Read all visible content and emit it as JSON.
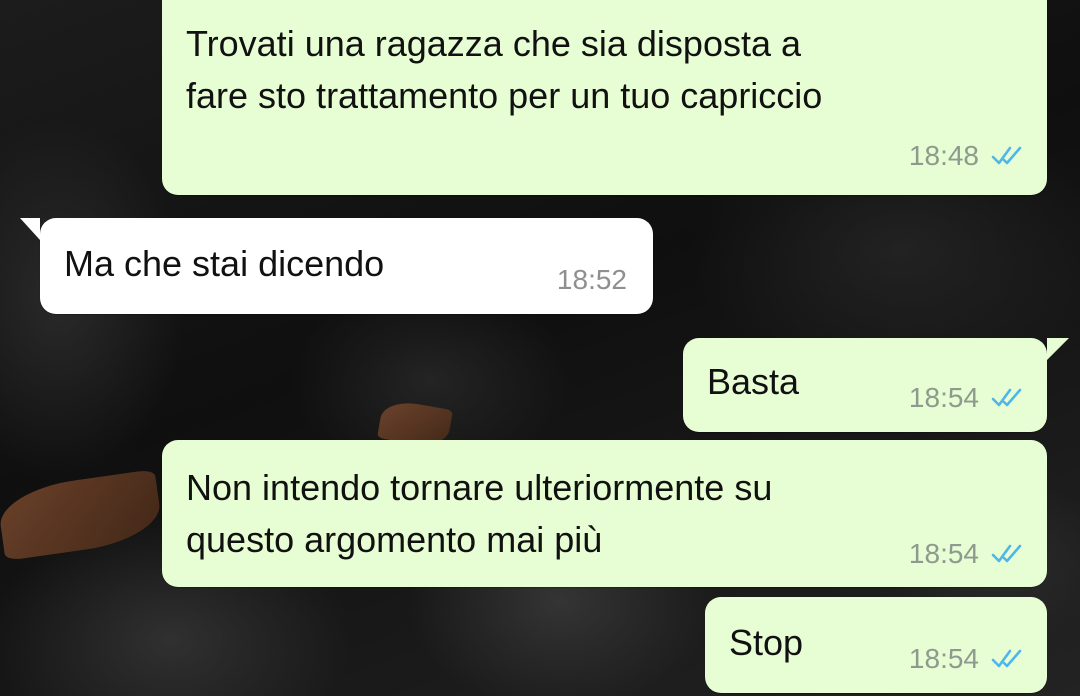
{
  "colors": {
    "outgoing_bubble": "#e7fdd3",
    "incoming_bubble": "#ffffff",
    "read_tick": "#4fb6ec"
  },
  "messages": [
    {
      "direction": "outgoing",
      "text": "Trovati una ragazza che sia disposta a\nfare sto trattamento per un tuo capriccio",
      "time": "18:48",
      "status_icon": "double-check-read-icon"
    },
    {
      "direction": "incoming",
      "text": "Ma che stai dicendo",
      "time": "18:52"
    },
    {
      "direction": "outgoing",
      "text": "Basta",
      "time": "18:54",
      "status_icon": "double-check-read-icon"
    },
    {
      "direction": "outgoing",
      "text": "Non intendo tornare ulteriormente su\nquesto argomento mai più",
      "time": "18:54",
      "status_icon": "double-check-read-icon"
    },
    {
      "direction": "outgoing",
      "text": "Stop",
      "time": "18:54",
      "status_icon": "double-check-read-icon"
    }
  ]
}
